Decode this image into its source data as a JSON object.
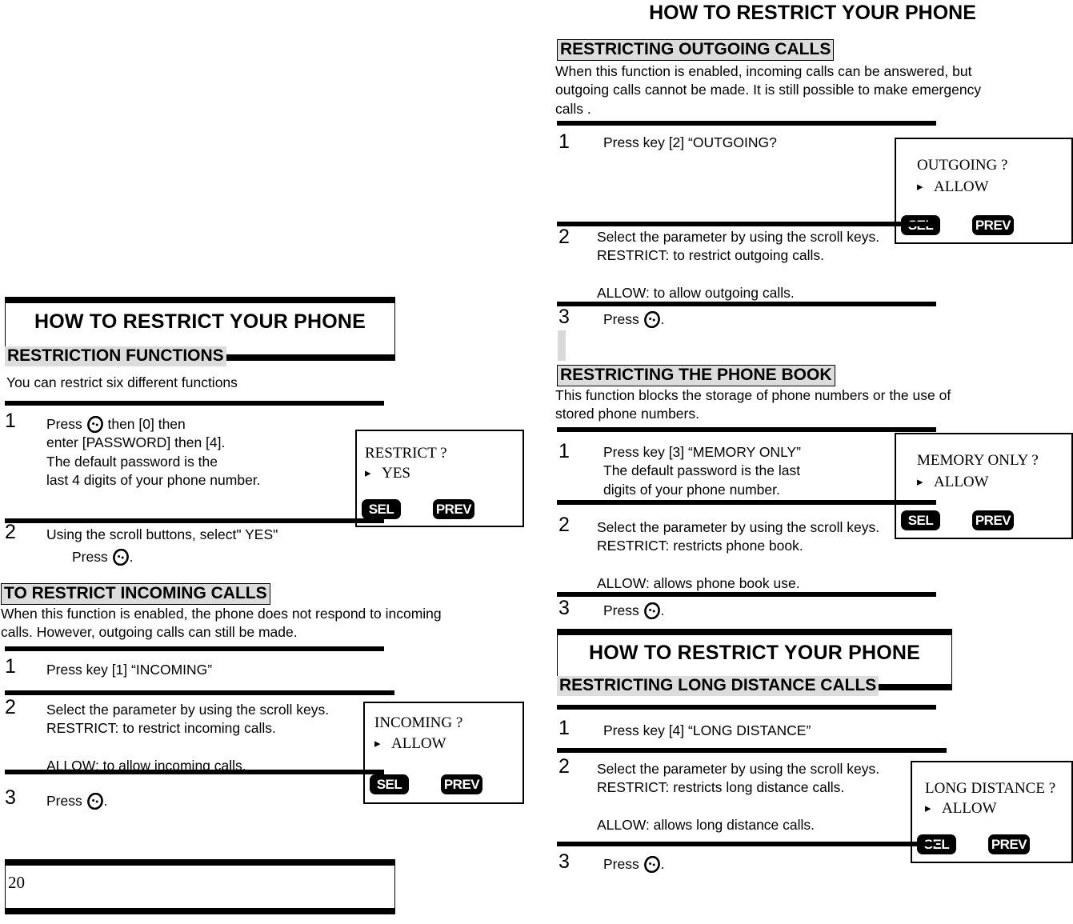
{
  "document": {
    "page_number": "20",
    "page_title": "HOW TO RESTRICT YOUR PHONE"
  },
  "icons": {
    "key_icon": "phone-key-icon",
    "arrow_icon": "right-pointer-icon"
  },
  "softkeys": {
    "sel": "SEL",
    "prev": "PREV"
  },
  "left_column": {
    "title": "HOW TO RESTRICT YOUR PHONE",
    "section": {
      "heading": "RESTRICTION FUNCTIONS",
      "intro": "You can restrict six different functions",
      "steps": [
        {
          "num": "1",
          "pre": "Press ",
          "post": " then [0] then\nenter [PASSWORD] then [4].\nThe default password is the\nlast 4 digits of your phone number."
        },
        {
          "num": "2",
          "line1": "Using the scroll buttons, select\" YES\"",
          "line2_pre": "Press ",
          "line2_post": "."
        }
      ],
      "lcd": {
        "line1": "RESTRICT ?",
        "line2": "YES"
      }
    },
    "section2": {
      "heading": "TO RESTRICT INCOMING CALLS",
      "intro": "When this function is enabled, the phone does not respond to incoming\ncalls. However, outgoing calls can still be made.",
      "steps": [
        {
          "num": "1",
          "text": "Press key [1] “INCOMING”"
        },
        {
          "num": "2",
          "text": "Select the parameter by using the scroll keys.\n     RESTRICT: to restrict incoming calls.\n\n     ALLOW: to allow incoming calls."
        },
        {
          "num": "3",
          "pre": "Press ",
          "post": "."
        }
      ],
      "lcd": {
        "line1": "INCOMING ?",
        "line2": "ALLOW"
      }
    }
  },
  "right_column": {
    "title": "HOW TO RESTRICT YOUR PHONE",
    "section_outgoing": {
      "heading": "RESTRICTING OUTGOING CALLS",
      "intro": " When this function is enabled, incoming calls can be answered, but\noutgoing calls cannot be made. It is still possible to make emergency\ncalls .",
      "steps": [
        {
          "num": "1",
          "text": "Press key [2] “OUTGOING?"
        },
        {
          "num": "2",
          "text": "Select the parameter by using the scroll keys.\n     RESTRICT: to restrict outgoing calls.\n\n     ALLOW: to allow outgoing calls."
        },
        {
          "num": "3",
          "pre": "Press ",
          "post": "."
        }
      ],
      "lcd": {
        "line1": "OUTGOING ?",
        "line2": "ALLOW"
      }
    },
    "section_phonebook": {
      "heading": "RESTRICTING THE PHONE BOOK",
      "intro": "This function blocks the storage of phone numbers or the use of\nstored phone numbers.",
      "steps": [
        {
          "num": "1",
          "text": "Press key [3] “MEMORY ONLY”\n     The default password is the last\n     digits of your phone number."
        },
        {
          "num": "2",
          "text": "Select the parameter by using the scroll keys.\n     RESTRICT: restricts phone book.\n\n     ALLOW: allows phone book use."
        },
        {
          "num": "3",
          "pre": "Press ",
          "post": "."
        }
      ],
      "lcd": {
        "line1": "MEMORY ONLY ?",
        "line2": "ALLOW"
      }
    },
    "section_longdistance": {
      "title": "HOW TO RESTRICT YOUR PHONE",
      "heading": "RESTRICTING LONG DISTANCE CALLS",
      "steps": [
        {
          "num": "1",
          "text": "Press key [4] “LONG DISTANCE”"
        },
        {
          "num": "2",
          "text": "Select the parameter by using the scroll keys.\n     RESTRICT: restricts long distance calls.\n\n     ALLOW: allows long distance calls."
        },
        {
          "num": "3",
          "pre": "Press ",
          "post": "."
        }
      ],
      "lcd": {
        "line1": "LONG DISTANCE ?",
        "line2": "ALLOW"
      }
    }
  }
}
